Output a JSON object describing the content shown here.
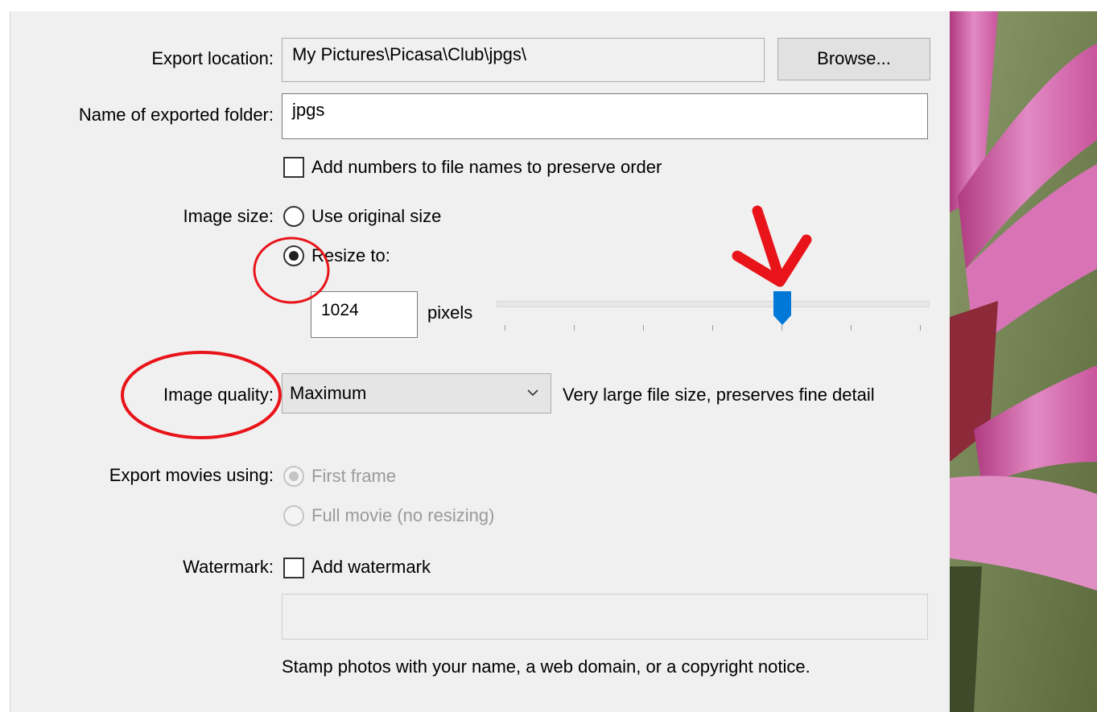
{
  "export_location": {
    "label": "Export location:",
    "value": "My Pictures\\Picasa\\Club\\jpgs\\",
    "browse_label": "Browse..."
  },
  "folder_name": {
    "label": "Name of exported folder:",
    "value": "jpgs"
  },
  "add_numbers": {
    "label": "Add numbers to file names to preserve order",
    "checked": false
  },
  "image_size": {
    "label": "Image size:",
    "option_original": "Use original size",
    "option_resize": "Resize to:",
    "selected": "resize",
    "pixels_value": "1024",
    "pixels_unit": "pixels",
    "slider_fraction": 0.66,
    "slider_ticks": 7
  },
  "image_quality": {
    "label": "Image quality:",
    "selected": "Maximum",
    "description": "Very large file size, preserves fine detail"
  },
  "export_movies": {
    "label": "Export movies using:",
    "option_first": "First frame",
    "option_full": "Full movie (no resizing)",
    "selected": "first",
    "disabled": true
  },
  "watermark": {
    "label": "Watermark:",
    "checkbox_label": "Add watermark",
    "checked": false,
    "text_value": "",
    "hint": "Stamp photos with your name, a web domain, or a copyright notice."
  },
  "annotations": {
    "color": "#e8141a",
    "items": [
      "circle-around-resize-radio",
      "ellipse-around-image-quality-label",
      "arrow-pointing-at-slider-thumb"
    ]
  },
  "colors": {
    "dialog_bg": "#f0f0f0",
    "slider_thumb": "#0078d7",
    "annotation": "#e8141a"
  }
}
